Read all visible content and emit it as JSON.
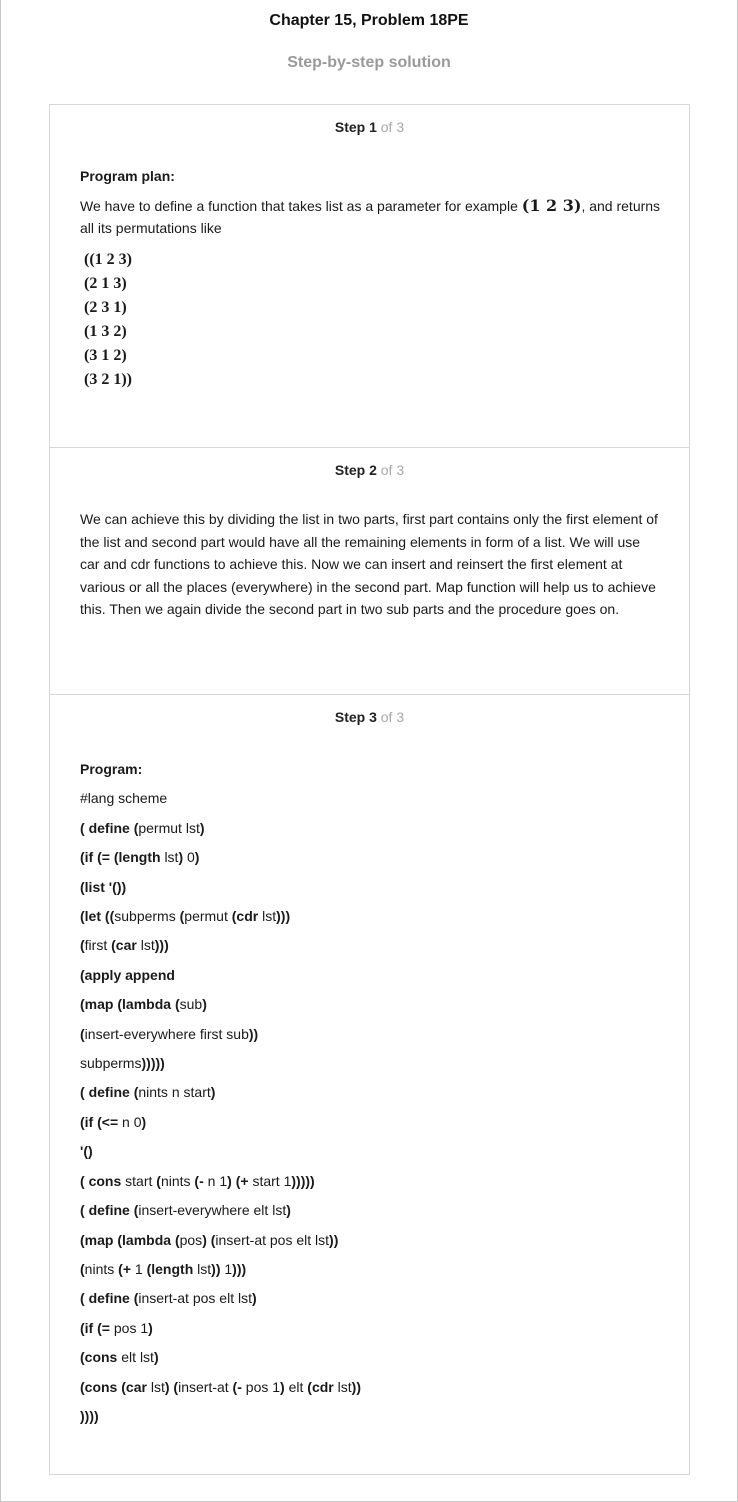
{
  "page": {
    "title": "Chapter 15, Problem 18PE",
    "subtitle": "Step-by-step solution"
  },
  "steps": [
    {
      "label": "Step 1",
      "of": "of 3",
      "heading": "Program plan:",
      "text_before": "We have to define a function that takes list as a parameter for example",
      "example": "(1 2 3)",
      "text_after": ", and returns all its permutations like",
      "permutations": [
        "((1 2 3)",
        "(2 1 3)",
        "(2 3 1)",
        "(1 3 2)",
        "(3 1 2)",
        "(3 2 1))"
      ]
    },
    {
      "label": "Step 2",
      "of": "of 3",
      "text": "We can achieve this by dividing the list in two parts, first part contains only the first element of the list and second part would have all the remaining elements in form of a list. We will use car and cdr functions to achieve this. Now we can insert and reinsert the first element at various or all the places (everywhere) in the second part. Map function will help us to achieve this. Then we again divide the second part in two sub parts and the procedure goes on."
    },
    {
      "label": "Step 3",
      "of": "of 3",
      "heading": "Program:",
      "code": [
        "#lang scheme",
        "( define (permut lst)",
        "(if (= (length lst) 0)",
        "(list '())",
        "(let ((subperms (permut (cdr lst)))",
        "(first (car lst)))",
        "(apply append",
        "(map (lambda (sub)",
        "(insert-everywhere first sub))",
        "subperms)))))",
        "( define (nints n start)",
        "(if (<= n 0)",
        "'()",
        "( cons start (nints (- n 1) (+ start 1)))))",
        "( define (insert-everywhere elt lst)",
        "(map (lambda (pos) (insert-at pos elt lst))",
        "(nints (+ 1 (length lst)) 1)))",
        "( define (insert-at pos elt lst)",
        "(if (= pos 1)",
        "(cons elt lst)",
        "(cons (car lst) (insert-at (- pos 1) elt (cdr lst))",
        "))))"
      ]
    }
  ]
}
